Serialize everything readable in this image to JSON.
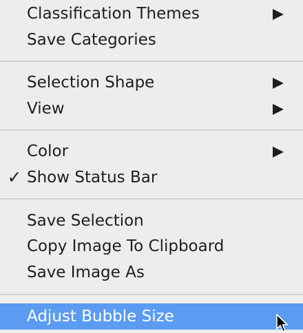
{
  "menu": {
    "items": {
      "classification_themes": {
        "label": "Classification Themes"
      },
      "save_categories": {
        "label": "Save Categories"
      },
      "selection_shape": {
        "label": "Selection Shape"
      },
      "view": {
        "label": "View"
      },
      "color": {
        "label": "Color"
      },
      "show_status_bar": {
        "label": "Show Status Bar",
        "check": "✓"
      },
      "save_selection": {
        "label": "Save Selection"
      },
      "copy_image": {
        "label": "Copy Image To Clipboard"
      },
      "save_image_as": {
        "label": "Save Image As"
      },
      "adjust_bubble_size": {
        "label": "Adjust Bubble Size"
      }
    },
    "colors": {
      "background": "#ededed",
      "highlight": "#5b9bf2",
      "text": "#1e1e1e",
      "separator": "#d2d2d2"
    }
  }
}
